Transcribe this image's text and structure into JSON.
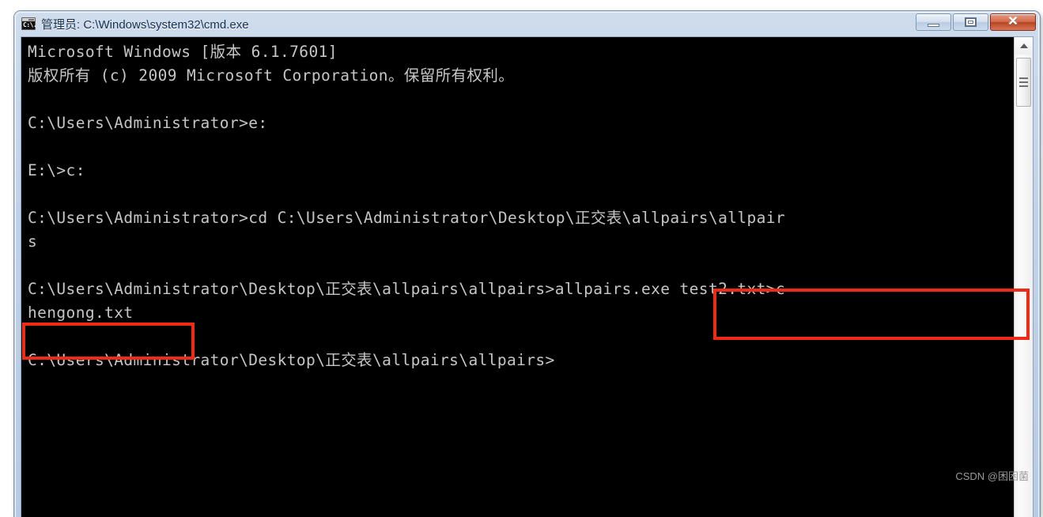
{
  "window": {
    "title": "管理员: C:\\Windows\\system32\\cmd.exe",
    "icon_name": "cmd-console-icon",
    "icon_text": "C:\\.",
    "buttons": {
      "minimize_label": "",
      "maximize_label": "",
      "close_label": "✕"
    }
  },
  "console": {
    "lines": [
      "Microsoft Windows [版本 6.1.7601]",
      "版权所有 (c) 2009 Microsoft Corporation。保留所有权利。",
      "",
      "C:\\Users\\Administrator>e:",
      "",
      "E:\\>c:",
      "",
      "C:\\Users\\Administrator>cd C:\\Users\\Administrator\\Desktop\\正交表\\allpairs\\allpair",
      "s",
      "",
      "C:\\Users\\Administrator\\Desktop\\正交表\\allpairs\\allpairs>allpairs.exe test2.txt>c",
      "hengong.txt",
      "",
      "C:\\Users\\Administrator\\Desktop\\正交表\\allpairs\\allpairs>",
      "",
      "",
      ""
    ]
  },
  "annotations": {
    "highlight_command": "allpairs.exe test2.txt>c",
    "highlight_wrap": "hengong.txt",
    "highlight_color": "#ef2b16"
  },
  "watermark": {
    "text": "CSDN @困困菌"
  }
}
